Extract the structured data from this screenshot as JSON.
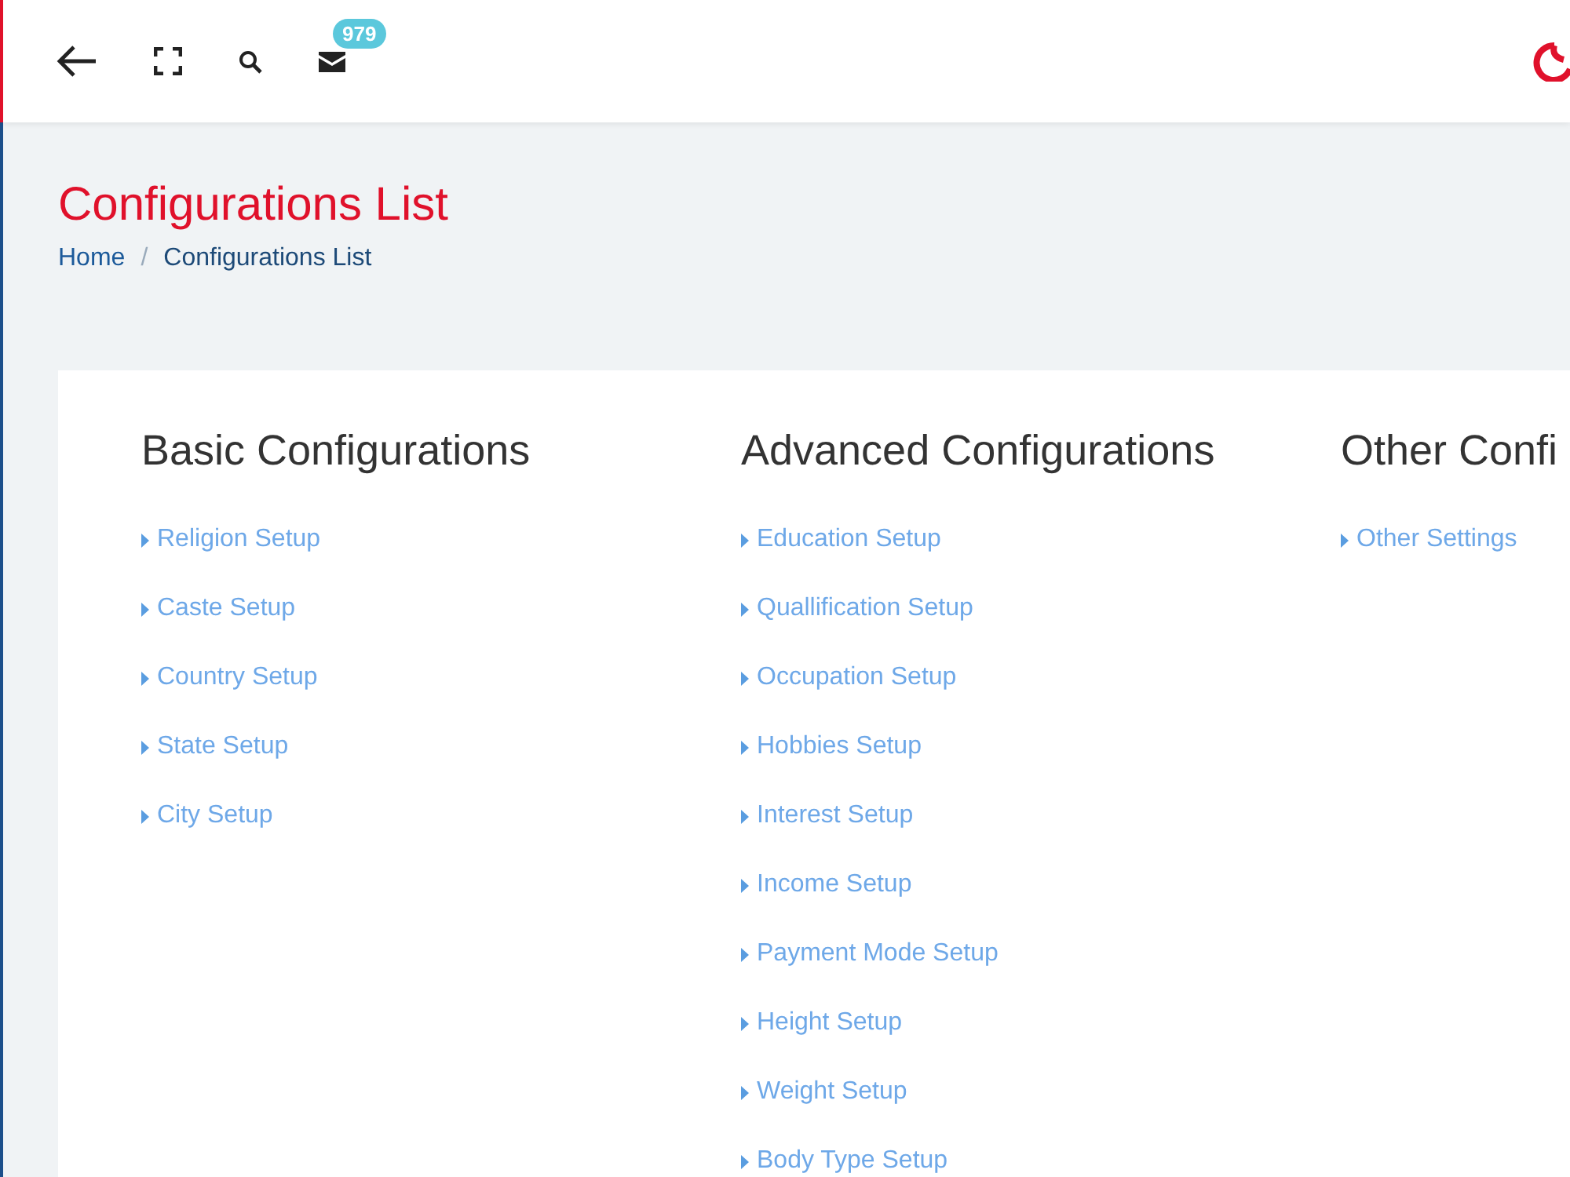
{
  "header": {
    "notifications": {
      "count": "979"
    }
  },
  "page": {
    "title": "Configurations List",
    "separator": "/",
    "breadcrumb": [
      {
        "label": "Home",
        "selected": false
      },
      {
        "label": "Configurations List",
        "selected": true
      }
    ]
  },
  "sections": [
    {
      "title": "Basic Configurations",
      "items": [
        "Religion Setup",
        "Caste Setup",
        "Country Setup",
        "State Setup",
        "City Setup"
      ]
    },
    {
      "title": "Advanced Configurations",
      "items": [
        "Education Setup",
        "Quallification Setup",
        "Occupation Setup",
        "Hobbies Setup",
        "Interest Setup",
        "Income Setup",
        "Payment Mode Setup",
        "Height Setup",
        "Weight Setup",
        "Body Type Setup"
      ]
    },
    {
      "title": "Other Confi",
      "items": [
        "Other Settings"
      ]
    }
  ]
}
